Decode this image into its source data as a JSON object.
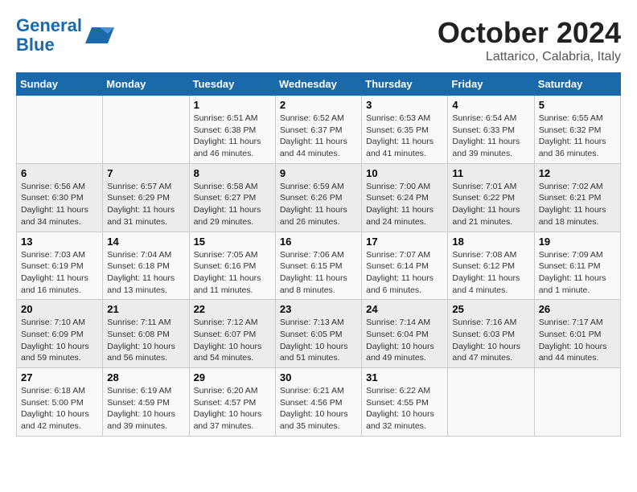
{
  "header": {
    "logo_line1": "General",
    "logo_line2": "Blue",
    "month_year": "October 2024",
    "location": "Lattarico, Calabria, Italy"
  },
  "days_of_week": [
    "Sunday",
    "Monday",
    "Tuesday",
    "Wednesday",
    "Thursday",
    "Friday",
    "Saturday"
  ],
  "weeks": [
    [
      {
        "day": "",
        "info": ""
      },
      {
        "day": "",
        "info": ""
      },
      {
        "day": "1",
        "info": "Sunrise: 6:51 AM\nSunset: 6:38 PM\nDaylight: 11 hours and 46 minutes."
      },
      {
        "day": "2",
        "info": "Sunrise: 6:52 AM\nSunset: 6:37 PM\nDaylight: 11 hours and 44 minutes."
      },
      {
        "day": "3",
        "info": "Sunrise: 6:53 AM\nSunset: 6:35 PM\nDaylight: 11 hours and 41 minutes."
      },
      {
        "day": "4",
        "info": "Sunrise: 6:54 AM\nSunset: 6:33 PM\nDaylight: 11 hours and 39 minutes."
      },
      {
        "day": "5",
        "info": "Sunrise: 6:55 AM\nSunset: 6:32 PM\nDaylight: 11 hours and 36 minutes."
      }
    ],
    [
      {
        "day": "6",
        "info": "Sunrise: 6:56 AM\nSunset: 6:30 PM\nDaylight: 11 hours and 34 minutes."
      },
      {
        "day": "7",
        "info": "Sunrise: 6:57 AM\nSunset: 6:29 PM\nDaylight: 11 hours and 31 minutes."
      },
      {
        "day": "8",
        "info": "Sunrise: 6:58 AM\nSunset: 6:27 PM\nDaylight: 11 hours and 29 minutes."
      },
      {
        "day": "9",
        "info": "Sunrise: 6:59 AM\nSunset: 6:26 PM\nDaylight: 11 hours and 26 minutes."
      },
      {
        "day": "10",
        "info": "Sunrise: 7:00 AM\nSunset: 6:24 PM\nDaylight: 11 hours and 24 minutes."
      },
      {
        "day": "11",
        "info": "Sunrise: 7:01 AM\nSunset: 6:22 PM\nDaylight: 11 hours and 21 minutes."
      },
      {
        "day": "12",
        "info": "Sunrise: 7:02 AM\nSunset: 6:21 PM\nDaylight: 11 hours and 18 minutes."
      }
    ],
    [
      {
        "day": "13",
        "info": "Sunrise: 7:03 AM\nSunset: 6:19 PM\nDaylight: 11 hours and 16 minutes."
      },
      {
        "day": "14",
        "info": "Sunrise: 7:04 AM\nSunset: 6:18 PM\nDaylight: 11 hours and 13 minutes."
      },
      {
        "day": "15",
        "info": "Sunrise: 7:05 AM\nSunset: 6:16 PM\nDaylight: 11 hours and 11 minutes."
      },
      {
        "day": "16",
        "info": "Sunrise: 7:06 AM\nSunset: 6:15 PM\nDaylight: 11 hours and 8 minutes."
      },
      {
        "day": "17",
        "info": "Sunrise: 7:07 AM\nSunset: 6:14 PM\nDaylight: 11 hours and 6 minutes."
      },
      {
        "day": "18",
        "info": "Sunrise: 7:08 AM\nSunset: 6:12 PM\nDaylight: 11 hours and 4 minutes."
      },
      {
        "day": "19",
        "info": "Sunrise: 7:09 AM\nSunset: 6:11 PM\nDaylight: 11 hours and 1 minute."
      }
    ],
    [
      {
        "day": "20",
        "info": "Sunrise: 7:10 AM\nSunset: 6:09 PM\nDaylight: 10 hours and 59 minutes."
      },
      {
        "day": "21",
        "info": "Sunrise: 7:11 AM\nSunset: 6:08 PM\nDaylight: 10 hours and 56 minutes."
      },
      {
        "day": "22",
        "info": "Sunrise: 7:12 AM\nSunset: 6:07 PM\nDaylight: 10 hours and 54 minutes."
      },
      {
        "day": "23",
        "info": "Sunrise: 7:13 AM\nSunset: 6:05 PM\nDaylight: 10 hours and 51 minutes."
      },
      {
        "day": "24",
        "info": "Sunrise: 7:14 AM\nSunset: 6:04 PM\nDaylight: 10 hours and 49 minutes."
      },
      {
        "day": "25",
        "info": "Sunrise: 7:16 AM\nSunset: 6:03 PM\nDaylight: 10 hours and 47 minutes."
      },
      {
        "day": "26",
        "info": "Sunrise: 7:17 AM\nSunset: 6:01 PM\nDaylight: 10 hours and 44 minutes."
      }
    ],
    [
      {
        "day": "27",
        "info": "Sunrise: 6:18 AM\nSunset: 5:00 PM\nDaylight: 10 hours and 42 minutes."
      },
      {
        "day": "28",
        "info": "Sunrise: 6:19 AM\nSunset: 4:59 PM\nDaylight: 10 hours and 39 minutes."
      },
      {
        "day": "29",
        "info": "Sunrise: 6:20 AM\nSunset: 4:57 PM\nDaylight: 10 hours and 37 minutes."
      },
      {
        "day": "30",
        "info": "Sunrise: 6:21 AM\nSunset: 4:56 PM\nDaylight: 10 hours and 35 minutes."
      },
      {
        "day": "31",
        "info": "Sunrise: 6:22 AM\nSunset: 4:55 PM\nDaylight: 10 hours and 32 minutes."
      },
      {
        "day": "",
        "info": ""
      },
      {
        "day": "",
        "info": ""
      }
    ]
  ]
}
